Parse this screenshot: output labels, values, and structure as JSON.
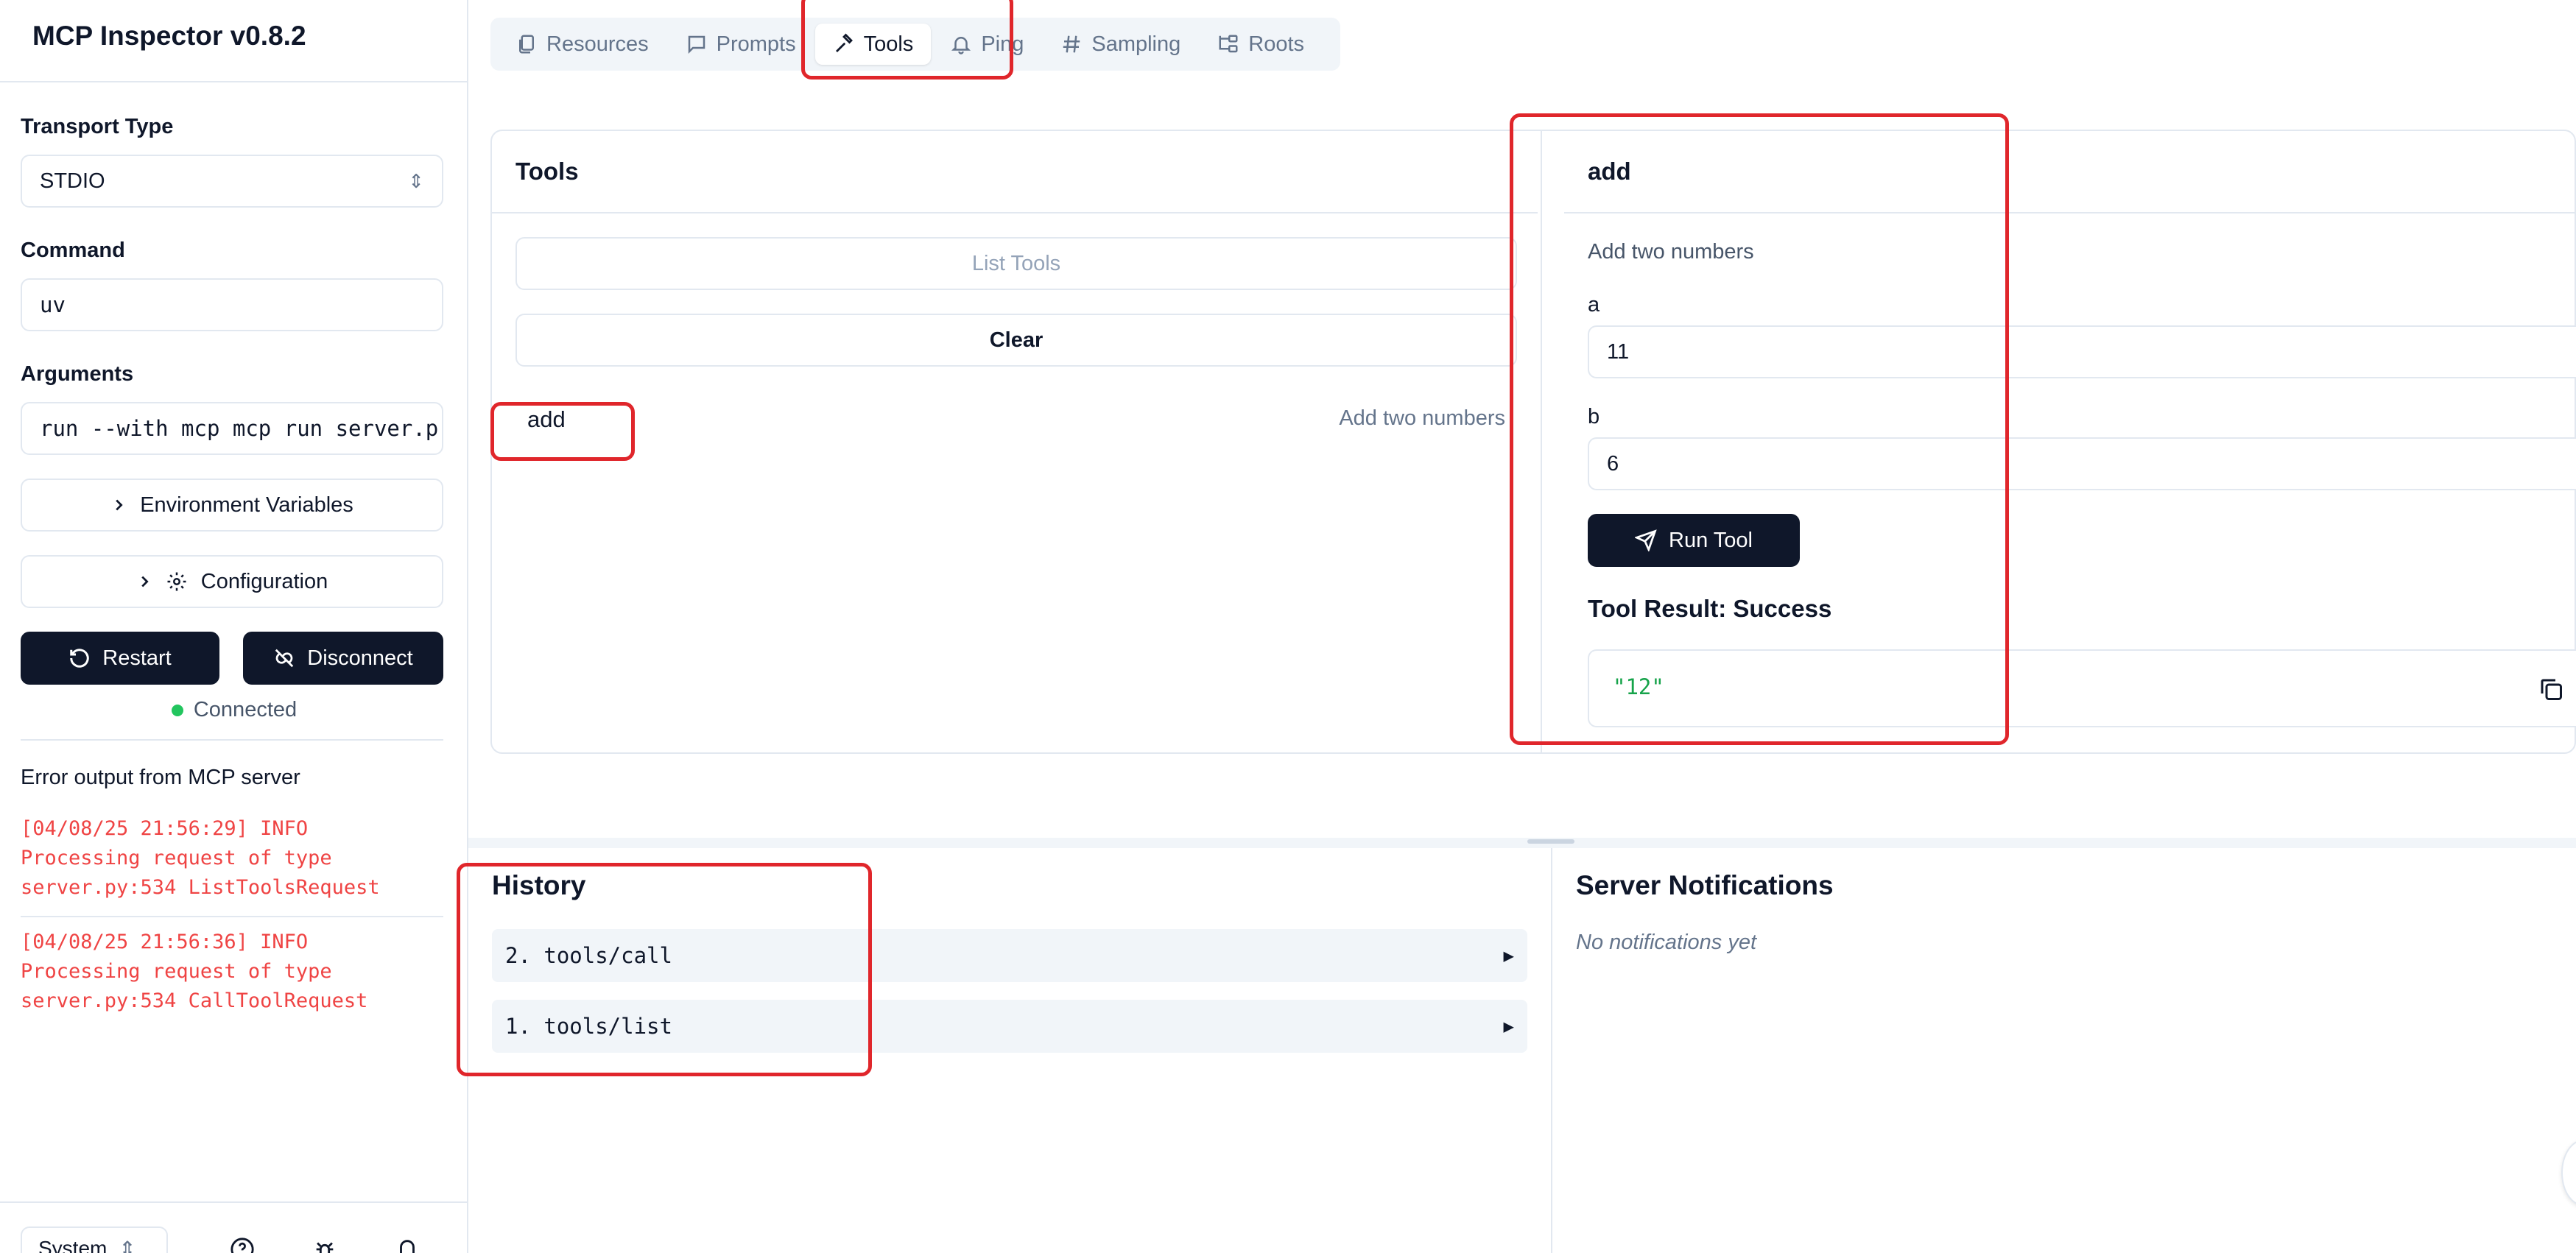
{
  "app": {
    "title": "MCP Inspector v0.8.2"
  },
  "sidebar": {
    "transport_label": "Transport Type",
    "transport_value": "STDIO",
    "command_label": "Command",
    "command_value": "uv",
    "arguments_label": "Arguments",
    "arguments_value": "run --with mcp mcp run server.p",
    "env_button": "Environment Variables",
    "config_button": "Configuration",
    "restart_button": "Restart",
    "disconnect_button": "Disconnect",
    "status": "Connected",
    "error_title": "Error output from MCP server",
    "logs": [
      "[04/08/25 21:56:29] INFO\nProcessing request of type\nserver.py:534 ListToolsRequest",
      "[04/08/25 21:56:36] INFO\nProcessing request of type\nserver.py:534 CallToolRequest"
    ],
    "theme_value": "System"
  },
  "tabs": [
    {
      "label": "Resources",
      "icon": "files-icon"
    },
    {
      "label": "Prompts",
      "icon": "message-icon"
    },
    {
      "label": "Tools",
      "icon": "hammer-icon",
      "active": true
    },
    {
      "label": "Ping",
      "icon": "bell-icon"
    },
    {
      "label": "Sampling",
      "icon": "hash-icon"
    },
    {
      "label": "Roots",
      "icon": "folder-tree-icon"
    }
  ],
  "tools": {
    "title": "Tools",
    "list_button": "List Tools",
    "clear_button": "Clear",
    "items": [
      {
        "name": "add",
        "description": "Add two numbers"
      }
    ]
  },
  "detail": {
    "title": "add",
    "description": "Add two numbers",
    "params": [
      {
        "label": "a",
        "value": "11"
      },
      {
        "label": "b",
        "value": "6"
      }
    ],
    "run_button": "Run Tool",
    "result_title": "Tool Result: Success",
    "result_value": "\"12\""
  },
  "history": {
    "title": "History",
    "items": [
      "2. tools/call",
      "1. tools/list"
    ]
  },
  "notifications": {
    "title": "Server Notifications",
    "empty": "No notifications yet"
  },
  "colors": {
    "primary": "#0f172a",
    "error": "#ef4444",
    "success": "#16a34a",
    "annotation": "#e0262b",
    "connected": "#22c55e"
  }
}
